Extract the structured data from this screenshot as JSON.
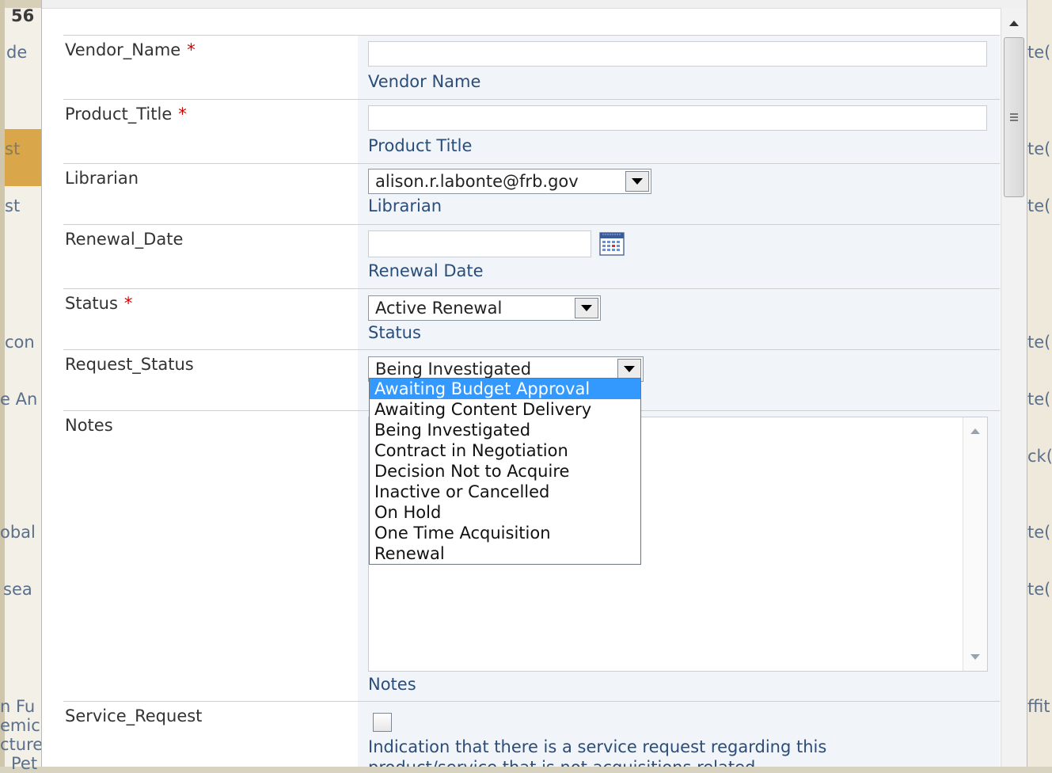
{
  "background": {
    "left_texts": [
      "56",
      "de",
      "st",
      "st",
      "con",
      "e An",
      "obal",
      "sea",
      "n Fu",
      "emic",
      "cture",
      "Pet"
    ],
    "right_texts": [
      "te(",
      "te(",
      "te(",
      "te(",
      "te(",
      "ck(",
      "te(",
      "te(",
      "ffit"
    ]
  },
  "form": {
    "vendor_name": {
      "label": "Vendor_Name",
      "required_mark": "*",
      "value": "",
      "description": "Vendor Name"
    },
    "product_title": {
      "label": "Product_Title",
      "required_mark": "*",
      "value": "",
      "description": "Product Title"
    },
    "librarian": {
      "label": "Librarian",
      "selected": "alison.r.labonte@frb.gov",
      "description": "Librarian"
    },
    "renewal_date": {
      "label": "Renewal_Date",
      "value": "",
      "description": "Renewal Date",
      "icon": "calendar-icon"
    },
    "status": {
      "label": "Status",
      "required_mark": "*",
      "selected": "Active Renewal",
      "description": "Status"
    },
    "request_status": {
      "label": "Request_Status",
      "selected": "Being Investigated",
      "options": [
        "Awaiting Budget Approval",
        "Awaiting Content Delivery",
        "Being Investigated",
        "Contract in Negotiation",
        "Decision Not to Acquire",
        "Inactive or Cancelled",
        "On Hold",
        "One Time Acquisition",
        "Renewal"
      ],
      "highlighted_option": "Awaiting Budget Approval"
    },
    "notes": {
      "label": "Notes",
      "value": "",
      "description": "Notes"
    },
    "service_request": {
      "label": "Service_Request",
      "checked": false,
      "description_line1": "Indication that there is a service request regarding this",
      "description_line2": "product/service that is not acquisitions related."
    }
  },
  "colors": {
    "accent_highlight": "#3399ff",
    "required": "#d40000",
    "description_text": "#2a4d7a",
    "field_background": "#f1f4f9",
    "background_band": "#d9a64a"
  }
}
